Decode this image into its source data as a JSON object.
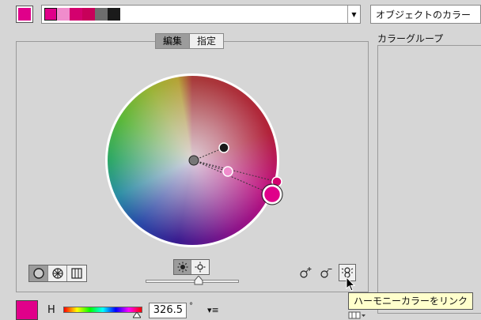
{
  "current_color": "#e0008a",
  "harmony": {
    "swatches": [
      "#e0008a",
      "#f08ccc",
      "#d4006e",
      "#c8005a",
      "#6e6e6e",
      "#1a1a1a"
    ]
  },
  "object_color_select": {
    "value": "オブジェクトのカラー"
  },
  "tabs": [
    {
      "label": "編集",
      "active": true
    },
    {
      "label": "指定",
      "active": false
    }
  ],
  "color_group": {
    "label": "カラーグループ"
  },
  "hsb": {
    "channel_label": "H",
    "value": "326.5",
    "unit": "°"
  },
  "tooltip": {
    "text": "ハーモニーカラーをリンク"
  },
  "icons": {
    "mode_smooth": "smooth-wheel-icon",
    "mode_segmented": "segmented-wheel-icon",
    "mode_bars": "color-bars-icon",
    "brightness": "sun-icon",
    "saturation": "sun-outline-icon",
    "add_marker": "add-color-marker-icon",
    "remove_marker": "remove-color-marker-icon",
    "link_harmony": "link-harmony-icon",
    "menu": "slider-menu-icon",
    "view": "view-options-icon"
  },
  "colors": {
    "link_active": "#111111",
    "tooltip_bg": "#ffffcc"
  }
}
